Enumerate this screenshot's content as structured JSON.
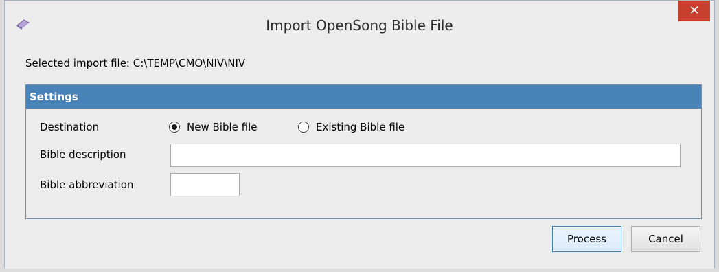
{
  "window": {
    "title": "Import OpenSong Bible File",
    "close_glyph": "✕"
  },
  "import": {
    "label": "Selected import file: C:\\TEMP\\CMO\\NIV\\NIV"
  },
  "settings": {
    "header": "Settings",
    "destination_label": "Destination",
    "radio_new_label": "New Bible file",
    "radio_existing_label": "Existing Bible file",
    "selected_destination": "New Bible file",
    "description_label": "Bible description",
    "description_value": "",
    "abbreviation_label": "Bible abbreviation",
    "abbreviation_value": ""
  },
  "buttons": {
    "process_label": "Process",
    "cancel_label": "Cancel"
  },
  "icons": {
    "app_icon": "book-icon",
    "close_icon": "close-icon"
  },
  "colors": {
    "settings_header_bg": "#4a83b8",
    "close_button_bg": "#c7402f"
  }
}
